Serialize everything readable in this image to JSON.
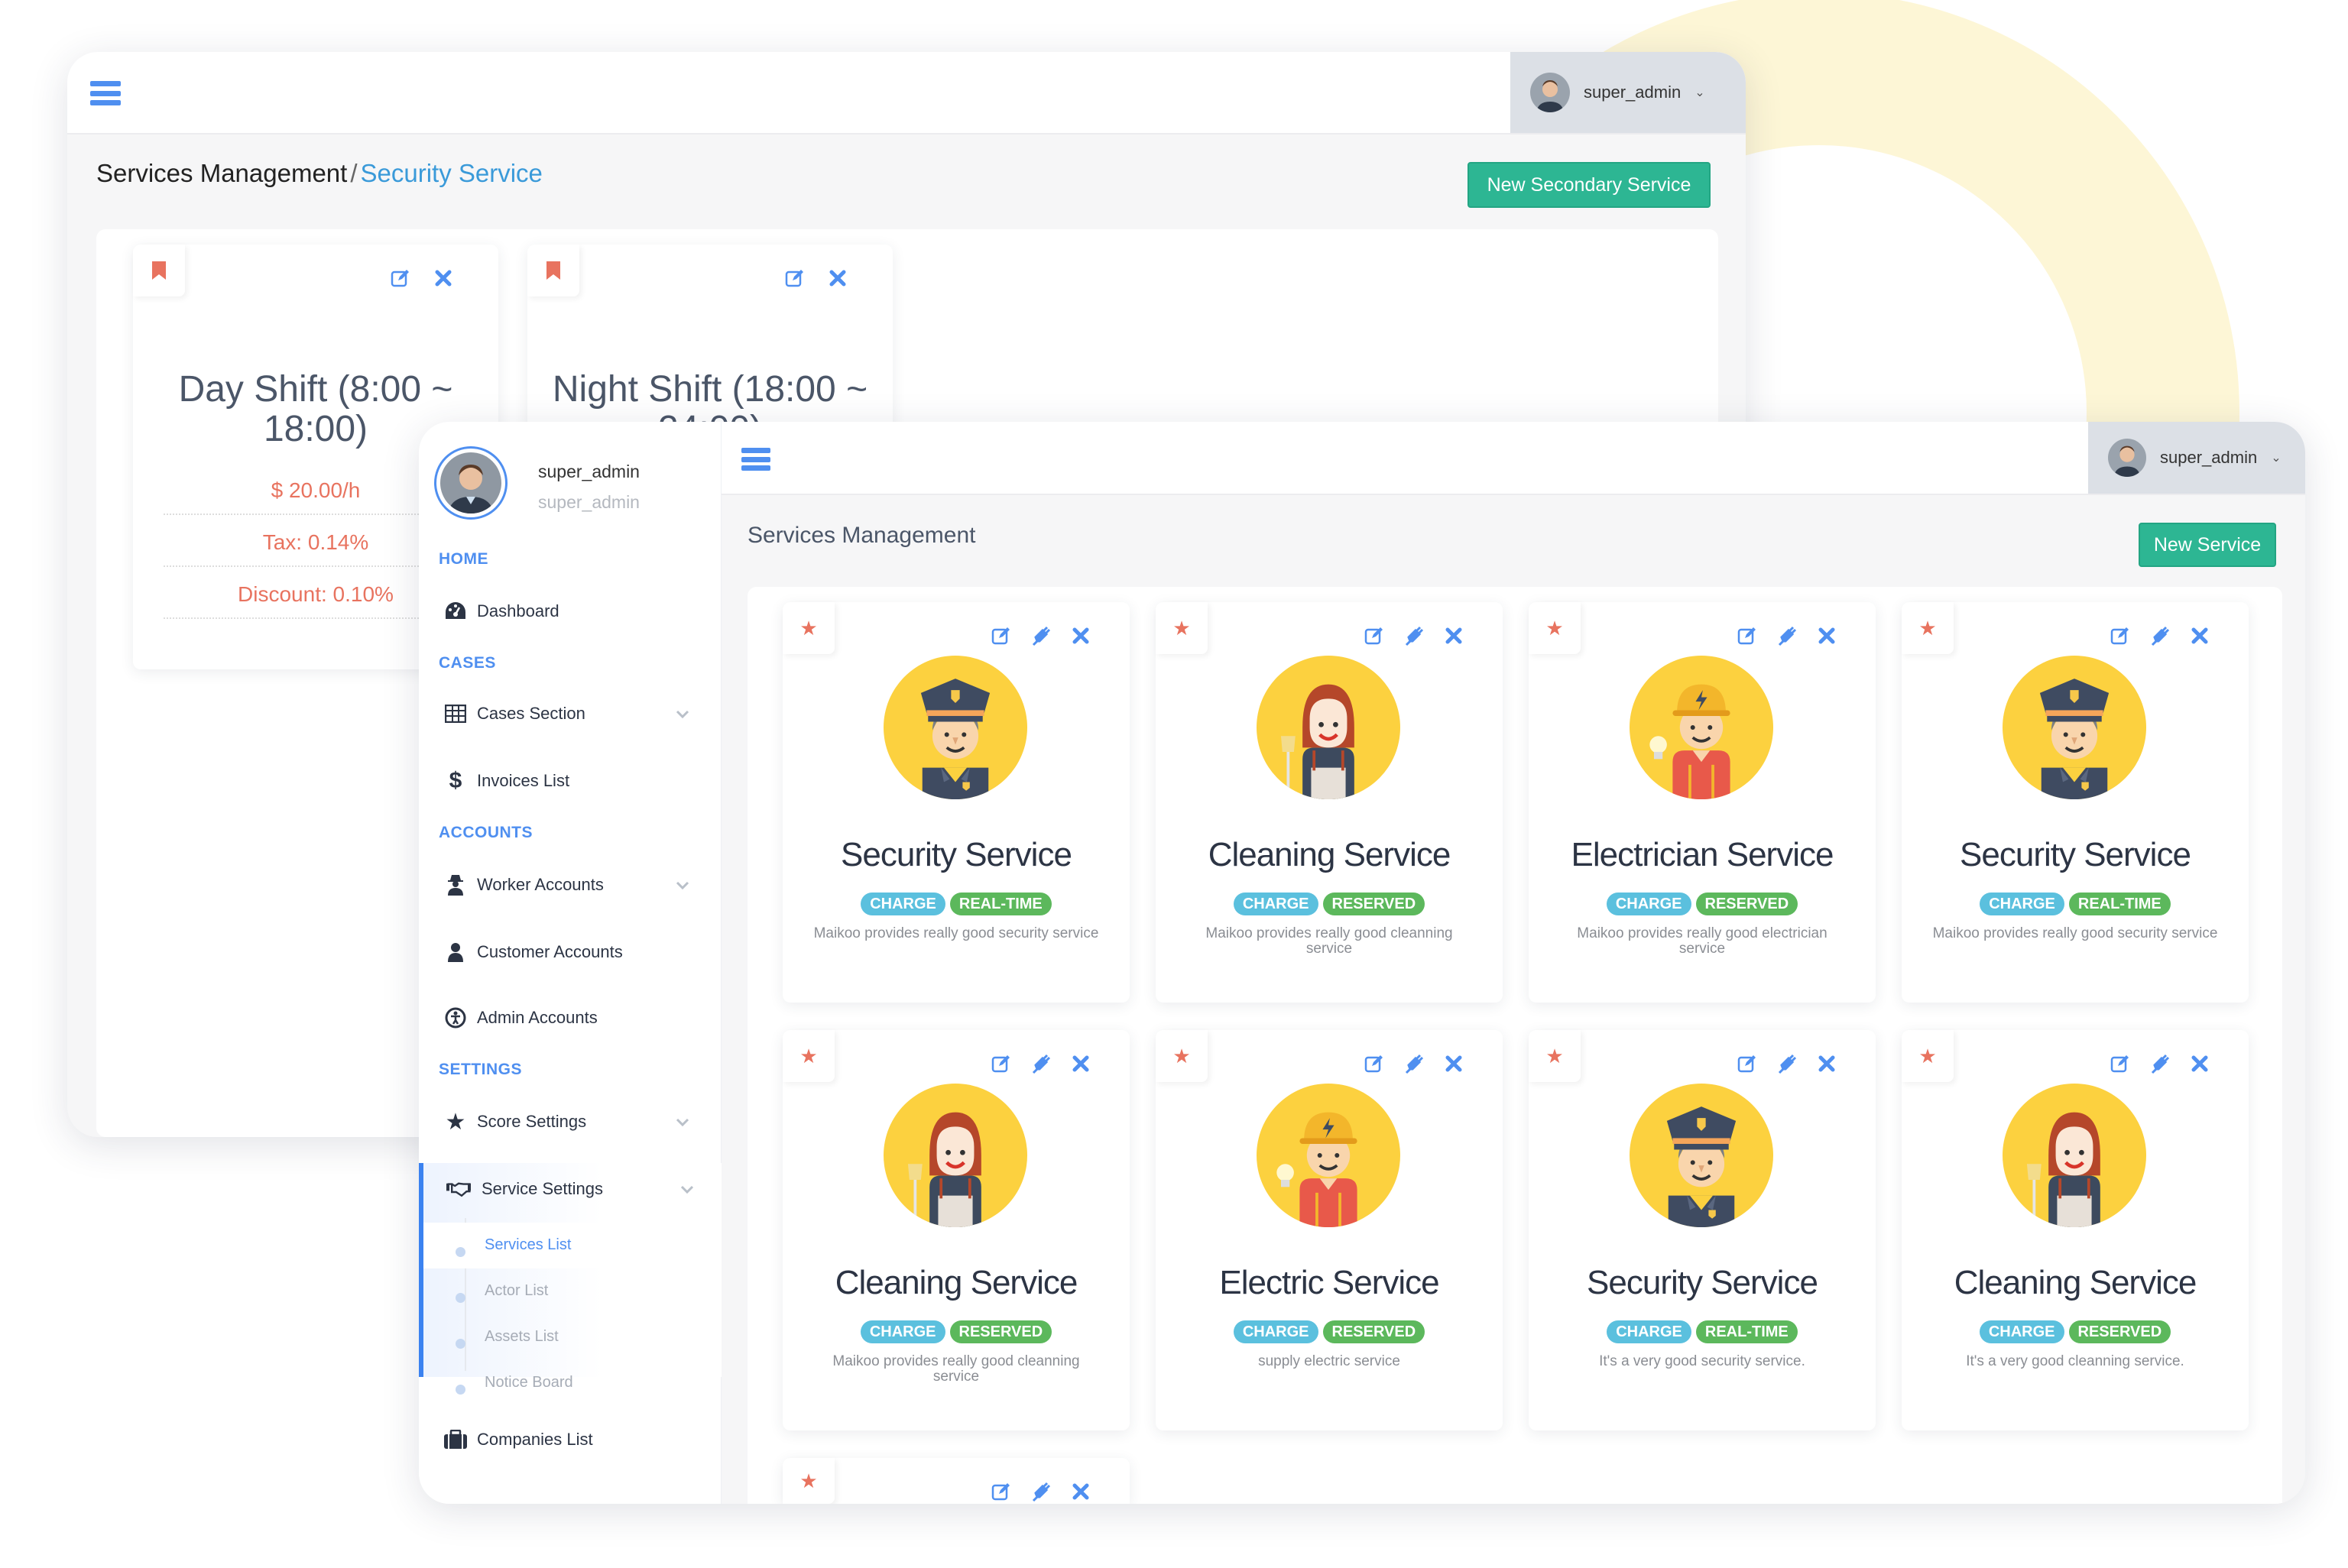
{
  "colors": {
    "accent": "#4f8ff0",
    "green_button": "#2db693",
    "charge": "#5bc0de",
    "green_badge": "#5cb85c",
    "star": "#e8735f"
  },
  "back_window": {
    "user": {
      "name": "super_admin"
    },
    "breadcrumb": {
      "root": "Services Management",
      "separator": "/",
      "current": "Security Service"
    },
    "new_button": "New Secondary Service",
    "shifts": [
      {
        "title": "Day Shift (8:00 ~ 18:00)",
        "price": "$ 20.00/h",
        "tax": "Tax: 0.14%",
        "discount": "Discount: 0.10%"
      },
      {
        "title": "Night Shift (18:00 ~ 24:00)"
      }
    ]
  },
  "front_window": {
    "user": {
      "name": "super_admin"
    },
    "sidebar": {
      "profile": {
        "name": "super_admin",
        "role": "super_admin"
      },
      "sections": {
        "home": "HOME",
        "cases": "CASES",
        "accounts": "ACCOUNTS",
        "settings": "SETTINGS"
      },
      "items": {
        "dashboard": "Dashboard",
        "cases_section": "Cases Section",
        "invoices": "Invoices List",
        "worker": "Worker Accounts",
        "customer": "Customer Accounts",
        "admin": "Admin Accounts",
        "score": "Score Settings",
        "service": "Service Settings",
        "companies": "Companies List"
      },
      "sub_items": [
        "Services List",
        "Actor List",
        "Assets List",
        "Notice Board"
      ]
    },
    "page_title": "Services Management",
    "new_button": "New Service",
    "services": [
      {
        "title": "Security Service",
        "avatar": "security",
        "badges": [
          "CHARGE",
          "REAL-TIME"
        ],
        "desc": "Maikoo provides really good security service"
      },
      {
        "title": "Cleaning Service",
        "avatar": "cleaning",
        "badges": [
          "CHARGE",
          "RESERVED"
        ],
        "desc": "Maikoo provides really good cleanning service"
      },
      {
        "title": "Electrician Service",
        "avatar": "electric",
        "badges": [
          "CHARGE",
          "RESERVED"
        ],
        "desc": "Maikoo provides really good electrician service"
      },
      {
        "title": "Security Service",
        "avatar": "security",
        "badges": [
          "CHARGE",
          "REAL-TIME"
        ],
        "desc": "Maikoo provides really good security service"
      },
      {
        "title": "Cleaning Service",
        "avatar": "cleaning",
        "badges": [
          "CHARGE",
          "RESERVED"
        ],
        "desc": "Maikoo provides really good cleanning service"
      },
      {
        "title": "Electric Service",
        "avatar": "electric",
        "badges": [
          "CHARGE",
          "RESERVED"
        ],
        "desc": "supply electric service"
      },
      {
        "title": "Security Service",
        "avatar": "security",
        "badges": [
          "CHARGE",
          "REAL-TIME"
        ],
        "desc": "It's a very good security service."
      },
      {
        "title": "Cleaning Service",
        "avatar": "cleaning",
        "badges": [
          "CHARGE",
          "RESERVED"
        ],
        "desc": "It's a very good cleanning service."
      },
      {
        "title": "",
        "avatar": "security",
        "badges": [],
        "desc": ""
      }
    ]
  }
}
